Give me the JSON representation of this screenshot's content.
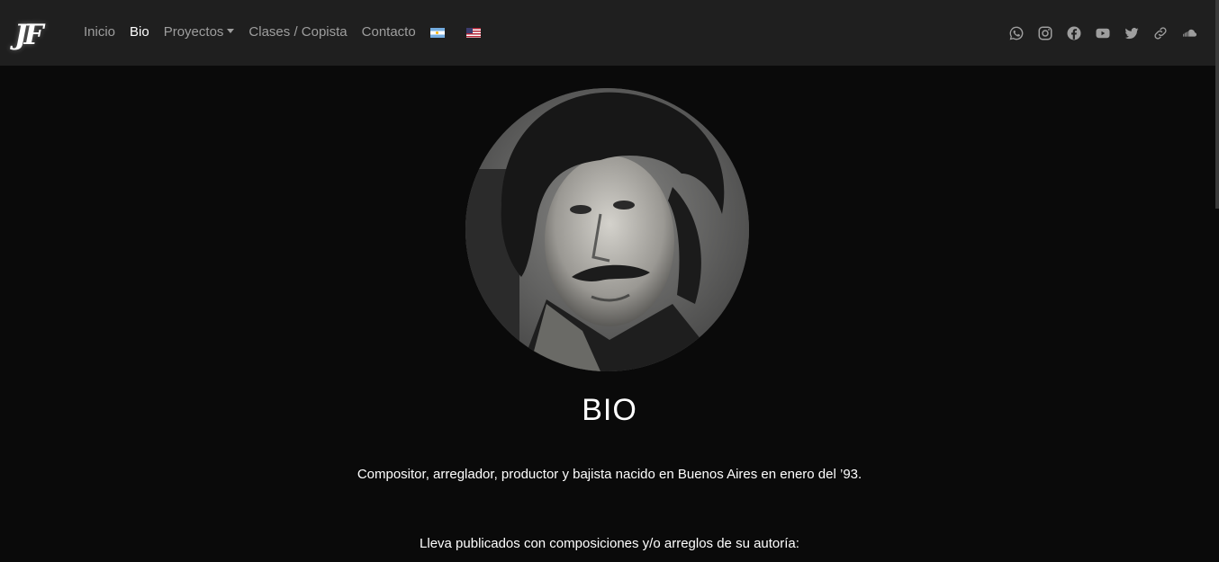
{
  "nav": {
    "logo": "JF",
    "links": [
      {
        "label": "Inicio",
        "active": false
      },
      {
        "label": "Bio",
        "active": true
      },
      {
        "label": "Proyectos",
        "active": false
      },
      {
        "label": "Clases / Copista",
        "active": false
      },
      {
        "label": "Contacto",
        "active": false
      }
    ],
    "flags": [
      "argentina-flag-icon",
      "usa-flag-icon"
    ],
    "social": [
      "whatsapp-icon",
      "instagram-icon",
      "facebook-icon",
      "youtube-icon",
      "twitter-icon",
      "link-icon",
      "soundcloud-icon"
    ],
    "icon_color": "#9e9e9e"
  },
  "main": {
    "title": "BIO",
    "paragraphs": [
      "Compositor, arreglador, productor y bajista nacido en Buenos Aires en enero del ’93.",
      "Lleva publicados con composiciones y/o arreglos de su autoría:"
    ]
  },
  "colors": {
    "background": "#0a0a0a",
    "navbar": "#1f1f1f",
    "active_link": "#ffffff",
    "link": "#9e9e9e"
  }
}
